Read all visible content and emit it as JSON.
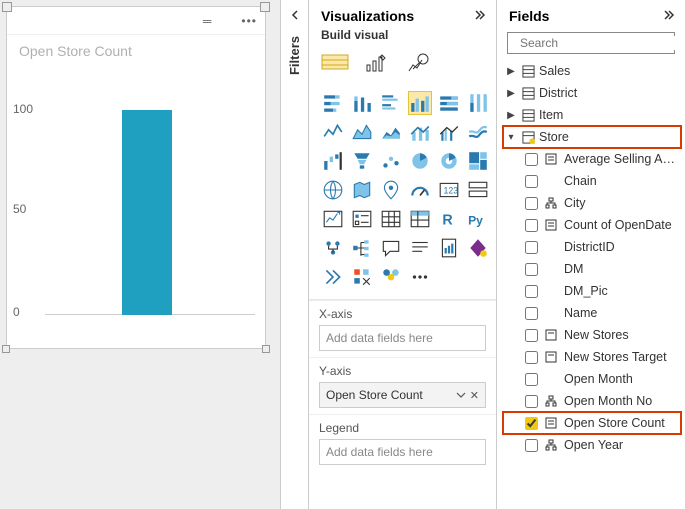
{
  "chart_data": {
    "type": "bar",
    "categories": [
      ""
    ],
    "values": [
      104
    ],
    "title": "Open Store Count",
    "xlabel": "",
    "ylabel": "",
    "ylim": [
      0,
      110
    ],
    "ticks": [
      0,
      50,
      100
    ]
  },
  "canvas": {
    "viz_title": "Open Store Count",
    "y100": "100",
    "y50": "50",
    "y0": "0"
  },
  "filters": {
    "label": "Filters"
  },
  "viz_panel": {
    "title": "Visualizations",
    "build_label": "Build visual",
    "xaxis_label": "X-axis",
    "xaxis_placeholder": "Add data fields here",
    "yaxis_label": "Y-axis",
    "yaxis_value": "Open Store Count",
    "legend_label": "Legend",
    "legend_placeholder": "Add data fields here"
  },
  "fields_panel": {
    "title": "Fields",
    "search_placeholder": "Search",
    "tables": {
      "sales": "Sales",
      "district": "District",
      "item": "Item",
      "store": "Store"
    },
    "store_fields": {
      "avg_selling": "Average Selling Area...",
      "chain": "Chain",
      "city": "City",
      "count_opendate": "Count of OpenDate",
      "district_id": "DistrictID",
      "dm": "DM",
      "dm_pic": "DM_Pic",
      "name": "Name",
      "new_stores": "New Stores",
      "new_stores_target": "New Stores Target",
      "open_month": "Open Month",
      "open_month_no": "Open Month No",
      "open_store_count": "Open Store Count",
      "open_year": "Open Year"
    }
  }
}
